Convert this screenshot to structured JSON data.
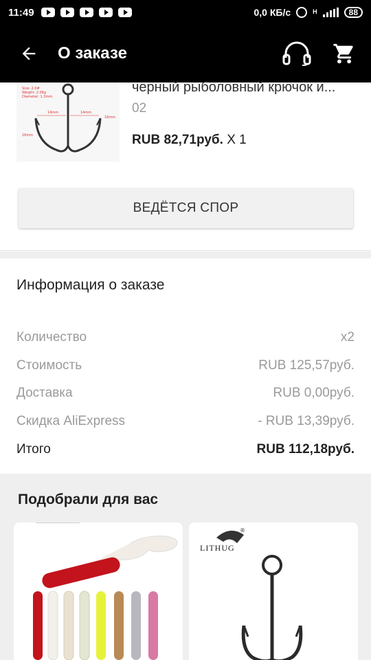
{
  "status_bar": {
    "time": "11:49",
    "network_speed": "0,0 КБ/с",
    "network_type": "H",
    "battery": "88"
  },
  "app_bar": {
    "title": "О заказе",
    "icons": [
      "back-arrow-icon",
      "headset-icon",
      "cart-icon"
    ]
  },
  "product": {
    "title": "черный рыболовный крючок и...",
    "variant": "02",
    "price": "RUB 82,71руб.",
    "quantity": "X 1",
    "image_labels": [
      "Size: 2.0#",
      "Weight: 2.06g",
      "Diameter: 1.3mm",
      "14mm",
      "14mm",
      "16mm",
      "16mm"
    ],
    "dispute_label": "ВЕДЁТСЯ СПОР"
  },
  "order_info": {
    "heading": "Информация о заказе",
    "rows": [
      {
        "label": "Количество",
        "value": "x2"
      },
      {
        "label": "Стоимость",
        "value": "RUB 125,57руб."
      },
      {
        "label": "Доставка",
        "value": "RUB 0,00руб."
      },
      {
        "label": "Скидка AliExpress",
        "value": "- RUB 13,39руб."
      },
      {
        "label": "Итого",
        "value": "RUB 112,18руб."
      }
    ]
  },
  "recommendations": {
    "heading": "Подобрали для вас",
    "cards": [
      {
        "brand_text": ""
      },
      {
        "brand_text": "LITHUG"
      }
    ]
  },
  "colors": {
    "bar_bg": "#000000",
    "section_bg": "#efefef",
    "muted_text": "#9a9a9a"
  }
}
